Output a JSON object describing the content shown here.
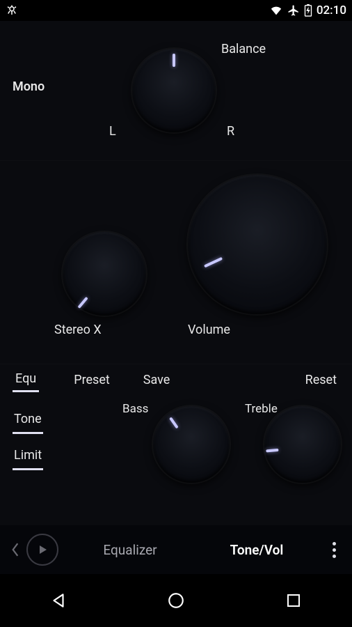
{
  "status": {
    "time": "02:10"
  },
  "balance": {
    "title": "Balance",
    "mono_label": "Mono",
    "left_label": "L",
    "right_label": "R",
    "angle": 0
  },
  "stereo": {
    "stereox_label": "Stereo X",
    "stereox_angle": -140,
    "volume_label": "Volume",
    "volume_angle": -115
  },
  "tone": {
    "top": {
      "equ": "Equ",
      "preset": "Preset",
      "save": "Save",
      "reset": "Reset"
    },
    "toggles": {
      "equ": "Equ",
      "tone": "Tone",
      "limit": "Limit"
    },
    "bass_label": "Bass",
    "bass_angle": -35,
    "treble_label": "Treble",
    "treble_angle": -95
  },
  "tabs": {
    "equalizer": "Equalizer",
    "tonevol": "Tone/Vol",
    "active": "tonevol"
  }
}
